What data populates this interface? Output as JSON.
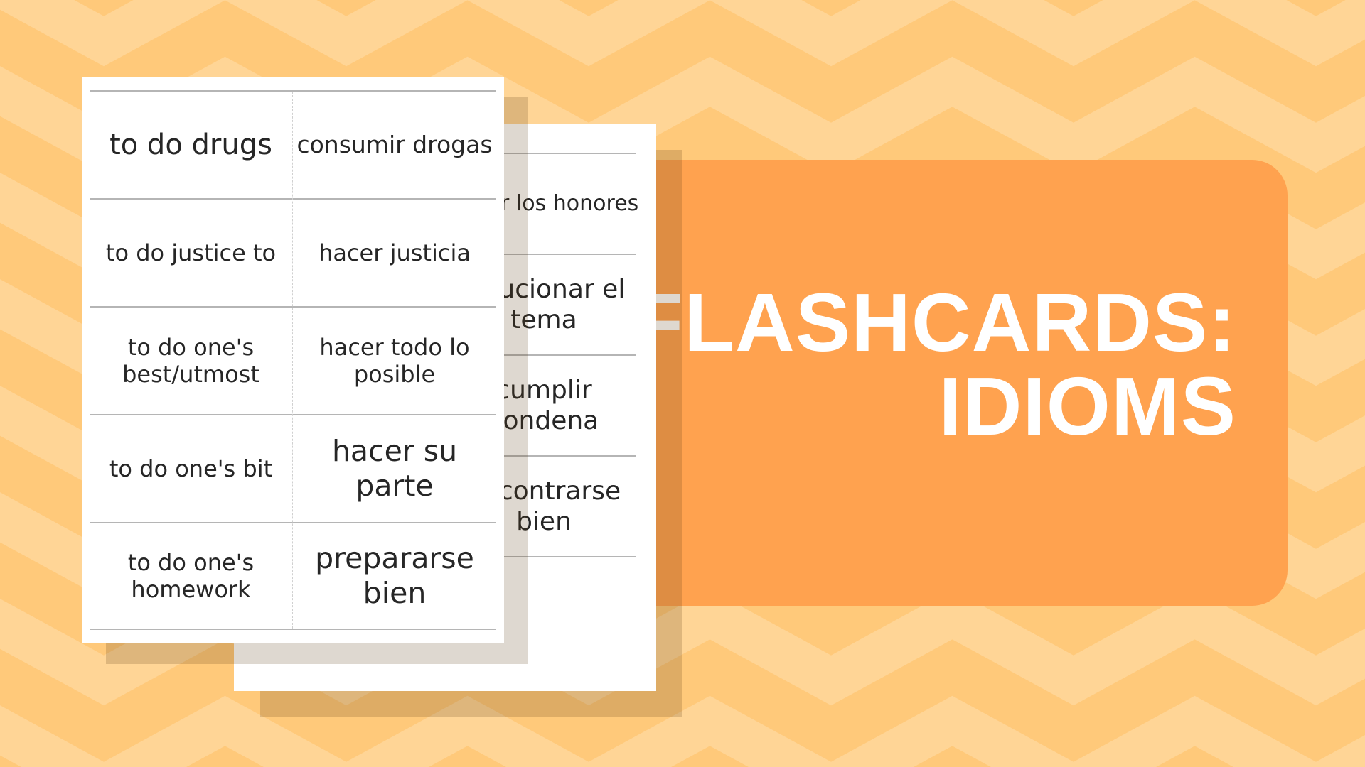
{
  "colors": {
    "background": "#ffc97a",
    "stripe": "#ffd596",
    "accent_box": "#ffa24f",
    "title": "#ffffff"
  },
  "title": {
    "line1": "FLASHCARDS:",
    "line2": "IDIOMS"
  },
  "front_card": {
    "rows": [
      {
        "english": "to do drugs",
        "spanish": "consumir drogas"
      },
      {
        "english": "to do justice to",
        "spanish": "hacer justicia"
      },
      {
        "english": "to do one's best/utmost",
        "spanish": "hacer todo lo posible"
      },
      {
        "english": "to do one's bit",
        "spanish": "hacer su parte"
      },
      {
        "english": "to do one's homework",
        "spanish": "prepararse bien"
      }
    ]
  },
  "back_card": {
    "rows": [
      {
        "spanish": "hacer los honores"
      },
      {
        "spanish": "solucionar el tema"
      },
      {
        "spanish": "cumplir condena"
      },
      {
        "spanish": "encontrarse bien"
      }
    ]
  }
}
